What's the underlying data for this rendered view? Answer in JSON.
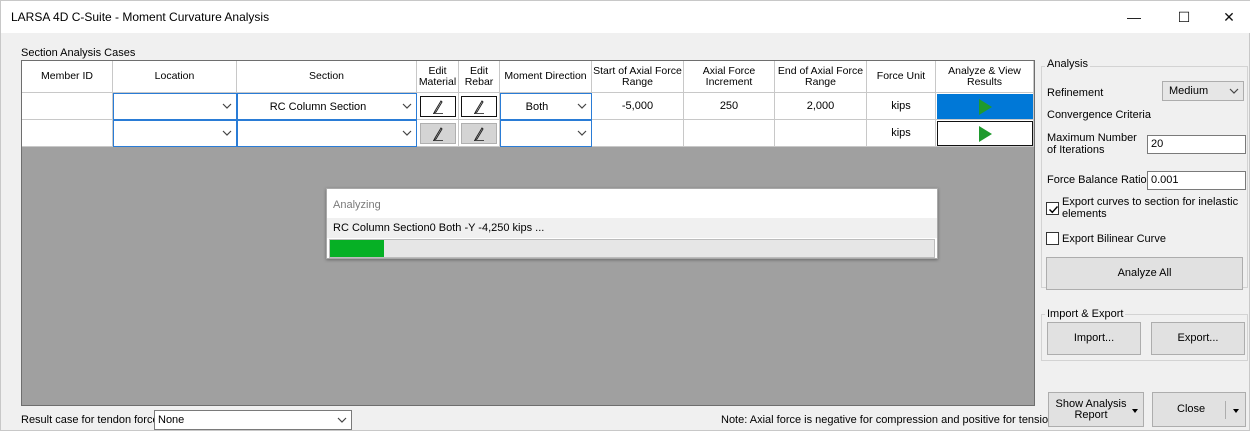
{
  "window": {
    "title": "LARSA 4D C-Suite - Moment Curvature Analysis",
    "minimize_glyph": "—",
    "maximize_glyph": "☐",
    "close_glyph": "✕"
  },
  "section_cases_label": "Section Analysis Cases",
  "grid": {
    "headers": {
      "member_id": "Member ID",
      "location": "Location",
      "section": "Section",
      "edit_material": "Edit Material",
      "edit_rebar": "Edit Rebar",
      "moment_direction": "Moment Direction",
      "start_axial": "Start of Axial Force Range",
      "axial_increment": "Axial Force Increment",
      "end_axial": "End of Axial Force Range",
      "force_unit": "Force Unit",
      "analyze_view": "Analyze & View Results"
    },
    "rows": [
      {
        "member_id": "",
        "location": "",
        "section": "RC Column Section",
        "moment_direction": "Both",
        "start_axial": "-5,000",
        "axial_increment": "250",
        "end_axial": "2,000",
        "force_unit": "kips"
      },
      {
        "member_id": "",
        "location": "",
        "section": "",
        "moment_direction": "",
        "start_axial": "",
        "axial_increment": "",
        "end_axial": "",
        "force_unit": "kips"
      }
    ]
  },
  "progress_dialog": {
    "title": "Analyzing",
    "message": "RC Column Section0 Both -Y -4,250 kips ...",
    "progress_fraction": 0.09
  },
  "bottom": {
    "tendon_label": "Result case for tendon forces",
    "tendon_value": "None",
    "note": "Note: Axial force is negative for compression and positive for tension."
  },
  "analysis_panel": {
    "title": "Analysis",
    "refinement_label": "Refinement",
    "refinement_value": "Medium",
    "convergence_label": "Convergence Criteria",
    "max_iter_label": "Maximum Number of Iterations",
    "max_iter_value": "20",
    "force_balance_label": "Force Balance Ratio",
    "force_balance_value": "0.001",
    "export_curves_label": "Export curves to section for inelastic elements",
    "export_curves_checked": true,
    "export_bilinear_label": "Export Bilinear Curve",
    "export_bilinear_checked": false,
    "analyze_all_label": "Analyze All"
  },
  "import_export_panel": {
    "title": "Import & Export",
    "import_label": "Import...",
    "export_label": "Export..."
  },
  "footer_buttons": {
    "show_report_label": "Show Analysis Report",
    "close_label": "Close"
  },
  "colors": {
    "selected_cell": "#0078d7",
    "play_green": "#1f9a2e",
    "progress_green": "#06b025",
    "grid_empty_area": "#a0a0a0"
  }
}
